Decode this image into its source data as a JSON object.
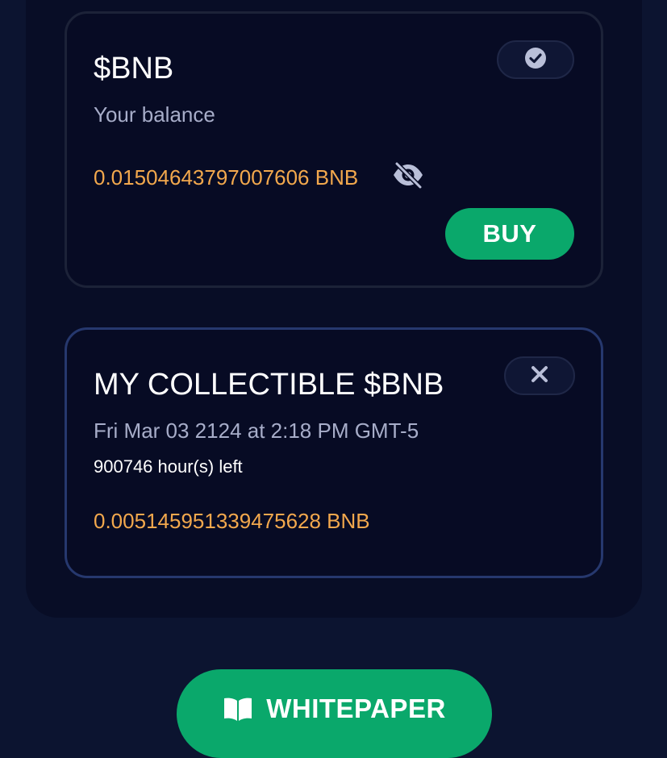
{
  "balance_card": {
    "title": "$BNB",
    "subtitle": "Your balance",
    "amount": "0.01504643797007606 BNB",
    "check_icon": "check-circle-icon",
    "visibility_icon": "eye-off-icon",
    "buy_label": "BUY"
  },
  "collectible_card": {
    "title": "MY COLLECTIBLE $BNB",
    "date": "Fri Mar 03 2124 at 2:18 PM GMT-5",
    "time_left": "900746 hour(s) left",
    "amount": "0.005145951339475628 BNB",
    "close_icon": "close-icon"
  },
  "whitepaper_button": {
    "label": "WHITEPAPER",
    "icon": "book-icon"
  },
  "colors": {
    "background": "#0c1430",
    "card": "#070b24",
    "accent_green": "#0aa86b",
    "amount_orange": "#f2a84d",
    "collectible_border": "#26386e"
  }
}
